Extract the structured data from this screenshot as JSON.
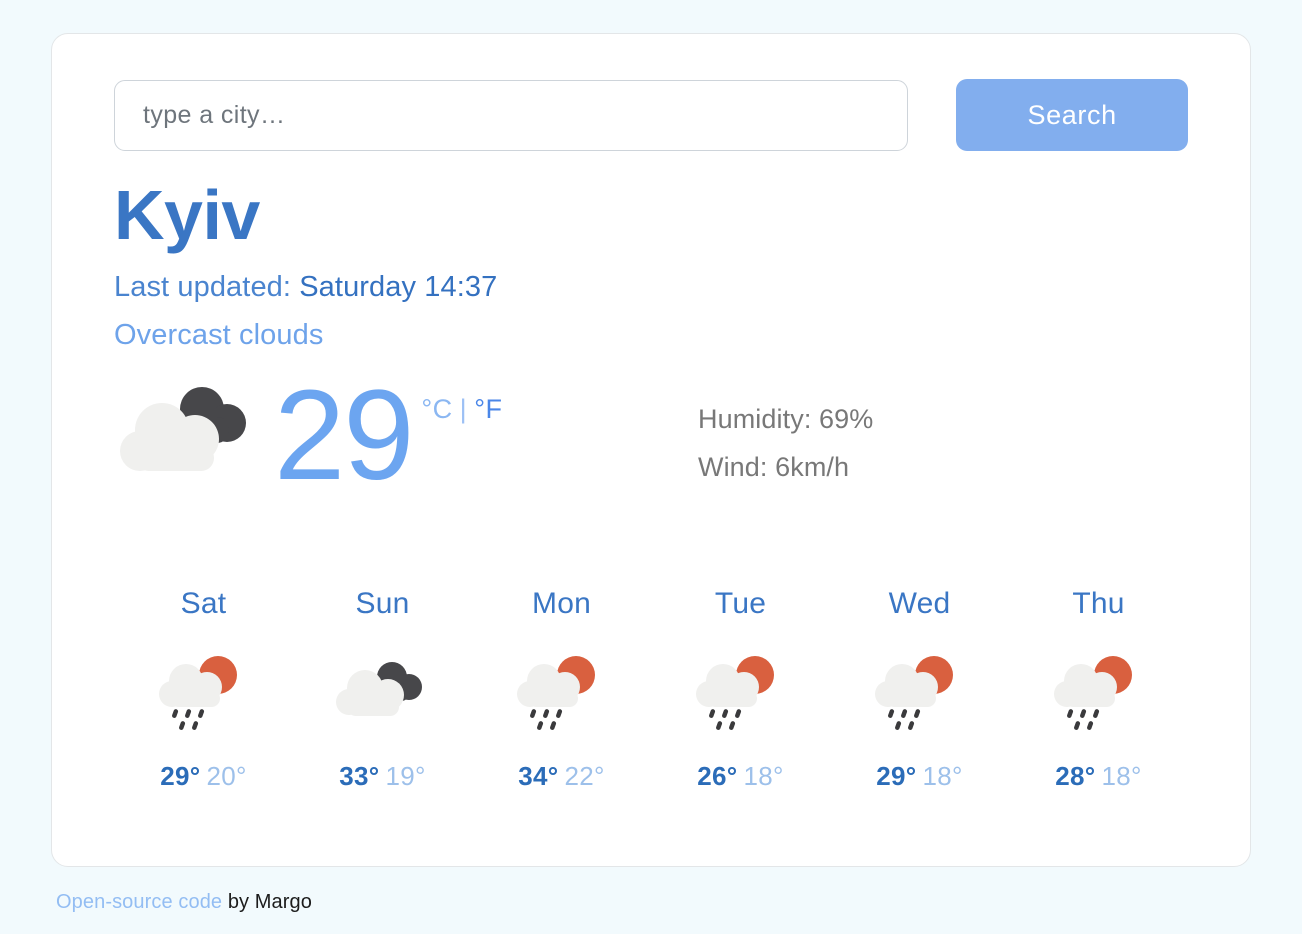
{
  "search": {
    "placeholder": "type a city…",
    "value": "",
    "button_label": "Search"
  },
  "current": {
    "city": "Kyiv",
    "updated_label": "Last updated:",
    "updated_value": "Saturday 14:37",
    "description": "Overcast clouds",
    "icon": "overcast-clouds-icon",
    "temperature": "29",
    "unit_celsius": "°C",
    "unit_separator": "|",
    "unit_fahrenheit": "°F",
    "humidity": "Humidity: 69%",
    "wind": "Wind: 6km/h"
  },
  "forecast": [
    {
      "day": "Sat",
      "icon": "rain-sun-icon",
      "max": "29°",
      "min": "20°"
    },
    {
      "day": "Sun",
      "icon": "overcast-clouds-icon",
      "max": "33°",
      "min": "19°"
    },
    {
      "day": "Mon",
      "icon": "rain-sun-icon",
      "max": "34°",
      "min": "22°"
    },
    {
      "day": "Tue",
      "icon": "rain-sun-icon",
      "max": "26°",
      "min": "18°"
    },
    {
      "day": "Wed",
      "icon": "rain-sun-icon",
      "max": "29°",
      "min": "18°"
    },
    {
      "day": "Thu",
      "icon": "rain-sun-icon",
      "max": "28°",
      "min": "18°"
    }
  ],
  "footer": {
    "link_text": "Open-source code",
    "author_text": " by Margo"
  },
  "colors": {
    "page_background": "#f2fafd",
    "card_background": "#ffffff",
    "accent_blue": "#82aeee",
    "heading_blue": "#3a76c4",
    "temp_blue": "#6ca5f0",
    "cloud_light": "#f0f0ee",
    "cloud_dark": "#47474a",
    "sun_orange": "#d9603f",
    "detail_gray": "#787878"
  }
}
